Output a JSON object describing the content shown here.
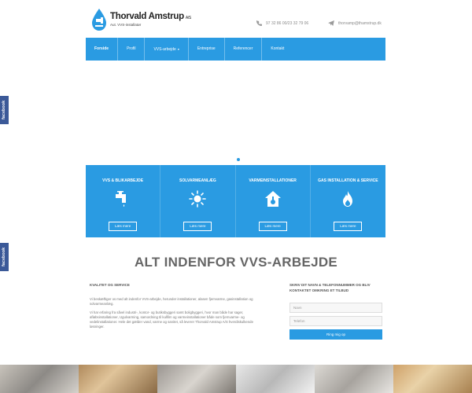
{
  "brand": {
    "name": "Thorvald Amstrup",
    "suffix": "A/S",
    "tagline": "Aut. VVS-installatør",
    "accent": "#2a9be2"
  },
  "contact": {
    "phone": "97 32 86 00/23 32 79 06",
    "email": "thorvamp@thamstrup.dk"
  },
  "nav": {
    "items": [
      {
        "label": "Forside"
      },
      {
        "label": "Profil"
      },
      {
        "label": "VVS-arbejde"
      },
      {
        "label": "Entreprise"
      },
      {
        "label": "Referencer"
      },
      {
        "label": "Kontakt"
      }
    ]
  },
  "side_tabs": [
    "facebook",
    "facebook"
  ],
  "services": [
    {
      "title": "VVS & BLIKARBEJDE",
      "icon": "faucet-icon",
      "button": "Læs mere"
    },
    {
      "title": "SOLVARMEANLÆG",
      "icon": "sun-icon",
      "button": "Læs mere"
    },
    {
      "title": "VARMEINSTALLATIONER",
      "icon": "house-thermometer-icon",
      "button": "Læs mere"
    },
    {
      "title": "GAS INSTALLATION & SERVICE",
      "icon": "flame-icon",
      "button": "Læs mere"
    }
  ],
  "main": {
    "title": "ALT INDENFOR VVS-ARBEJDE",
    "subtitle": "KVALITET OG SERVICE",
    "paragraphs": [
      "Vi beskæftiger os med alt indenfor VVS-arbejde, herunder installationer, alasen fjernvarme, gasinstallation og solvarmeanlæg.",
      "Vi har erfaring fra såvel industri-, kontor- og butiksbyggeri samt boligbyggeri, hvor man både har sager, afløbsinstallationer, Ugulvarming, samordning til kulfilm og varmeinstallationer både som fjernvarme- og vedelinstallationer. Hele det gælder vand, varme og sanitet, så leverer Thorvald Amstrup A/S hverdiskulkende løsninger."
    ]
  },
  "form": {
    "title": "SKRIV DIT NAVN & TELEFONNUMMER OG BLIV KONTAKTET OMKRING ET TILBUD",
    "name_placeholder": "Navn",
    "phone_placeholder": "Telefon",
    "button": "Ring mig op"
  }
}
